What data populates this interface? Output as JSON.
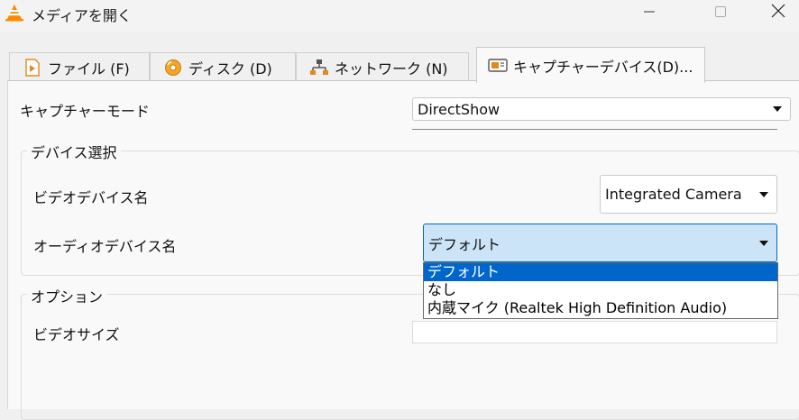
{
  "window": {
    "title": "メディアを開く",
    "controls": {
      "minimize": "—",
      "maximize": "☐",
      "close": "✕"
    }
  },
  "tabs": [
    {
      "label": "ファイル (F)",
      "icon": "file-play-icon",
      "selected": false
    },
    {
      "label": "ディスク (D)",
      "icon": "disc-icon",
      "selected": false
    },
    {
      "label": "ネットワーク (N)",
      "icon": "network-icon",
      "selected": false
    },
    {
      "label": "キャプチャーデバイス(D)...",
      "icon": "capture-device-icon",
      "selected": true
    }
  ],
  "capture": {
    "mode_label": "キャプチャーモード",
    "mode_value": "DirectShow",
    "device_group_title": "デバイス選択",
    "video_label": "ビデオデバイス名",
    "video_value": "Integrated Camera",
    "audio_label": "オーディオデバイス名",
    "audio_value": "デフォルト",
    "audio_options": [
      "デフォルト",
      "なし",
      "内蔵マイク (Realtek High Definition Audio)"
    ],
    "audio_selected_index": 0,
    "options_group_title": "オプション",
    "video_size_label": "ビデオサイズ",
    "video_size_value": ""
  },
  "colors": {
    "accent": "#0067c0",
    "selection": "#0066cc",
    "focus_fill": "#cce4f7",
    "vlc_orange": "#ff8800"
  }
}
